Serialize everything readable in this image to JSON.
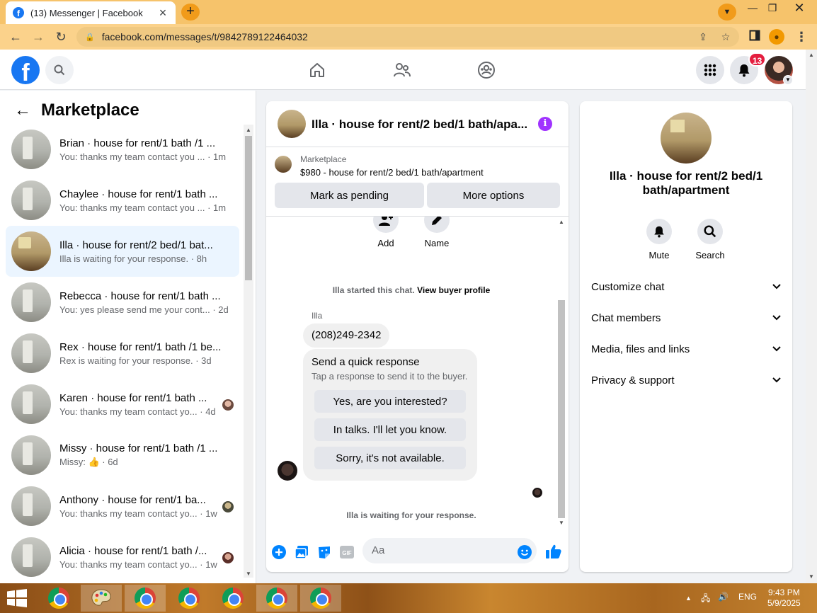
{
  "browser": {
    "tab_title": "(13) Messenger | Facebook",
    "url": "facebook.com/messages/t/9842789122464032"
  },
  "header": {
    "notification_count": "13"
  },
  "sidebar": {
    "title": "Marketplace",
    "conversations": [
      {
        "name": "Brian · house for rent/1 bath /1 ...",
        "preview": "You: thanks my team contact you ...",
        "time": "· 1m",
        "active": false
      },
      {
        "name": "Chaylee · house for rent/1 bath ...",
        "preview": "You: thanks my team contact you ...",
        "time": "· 1m",
        "active": false
      },
      {
        "name": "Illa · house for rent/2 bed/1 bat...",
        "preview": "Illa is waiting for your response.",
        "time": "· 8h",
        "active": true
      },
      {
        "name": "Rebecca · house for rent/1 bath ...",
        "preview": "You: yes please send me your cont...",
        "time": "· 2d",
        "active": false
      },
      {
        "name": "Rex · house for rent/1 bath /1 be...",
        "preview": "Rex is waiting for your response.",
        "time": "· 3d",
        "active": false
      },
      {
        "name": "Karen · house for rent/1 bath ...",
        "preview": "You: thanks my team contact yo...",
        "time": "· 4d",
        "active": false
      },
      {
        "name": "Missy · house for rent/1 bath /1 ...",
        "preview": "Missy: 👍",
        "time": "· 6d",
        "active": false
      },
      {
        "name": "Anthony · house for rent/1 ba...",
        "preview": "You: thanks my team contact yo...",
        "time": "· 1w",
        "active": false
      },
      {
        "name": "Alicia · house for rent/1 bath /...",
        "preview": "You: thanks my team contact yo...",
        "time": "· 1w",
        "active": false
      }
    ]
  },
  "chat": {
    "title": "Illa · house for rent/2 bed/1 bath/apa...",
    "marketplace_label": "Marketplace",
    "listing": "$980 - house for rent/2 bed/1 bath/apartment",
    "mark_pending": "Mark as pending",
    "more_options": "More options",
    "add_label": "Add",
    "name_label": "Name",
    "started_text": "Illa started this chat.",
    "view_profile": "View buyer profile",
    "sender_name": "Illa",
    "phone_message": "(208)249-2342",
    "quick_title": "Send a quick response",
    "quick_sub": "Tap a response to send it to the buyer.",
    "quick_options": [
      "Yes, are you interested?",
      "In talks. I'll let you know.",
      "Sorry, it's not available."
    ],
    "waiting_text": "Illa is waiting for your response.",
    "input_placeholder": "Aa"
  },
  "details": {
    "name": "Illa · house for rent/2 bed/1 bath/apartment",
    "mute_label": "Mute",
    "search_label": "Search",
    "sections": [
      "Customize chat",
      "Chat members",
      "Media, files and links",
      "Privacy & support"
    ]
  },
  "taskbar": {
    "language": "ENG",
    "time": "9:43 PM",
    "date": "5/9/2025"
  },
  "colors": {
    "fb_blue": "#1877f2",
    "info_purple": "#a033ff",
    "badge_red": "#e41e3f",
    "active_row": "#ebf5ff"
  }
}
